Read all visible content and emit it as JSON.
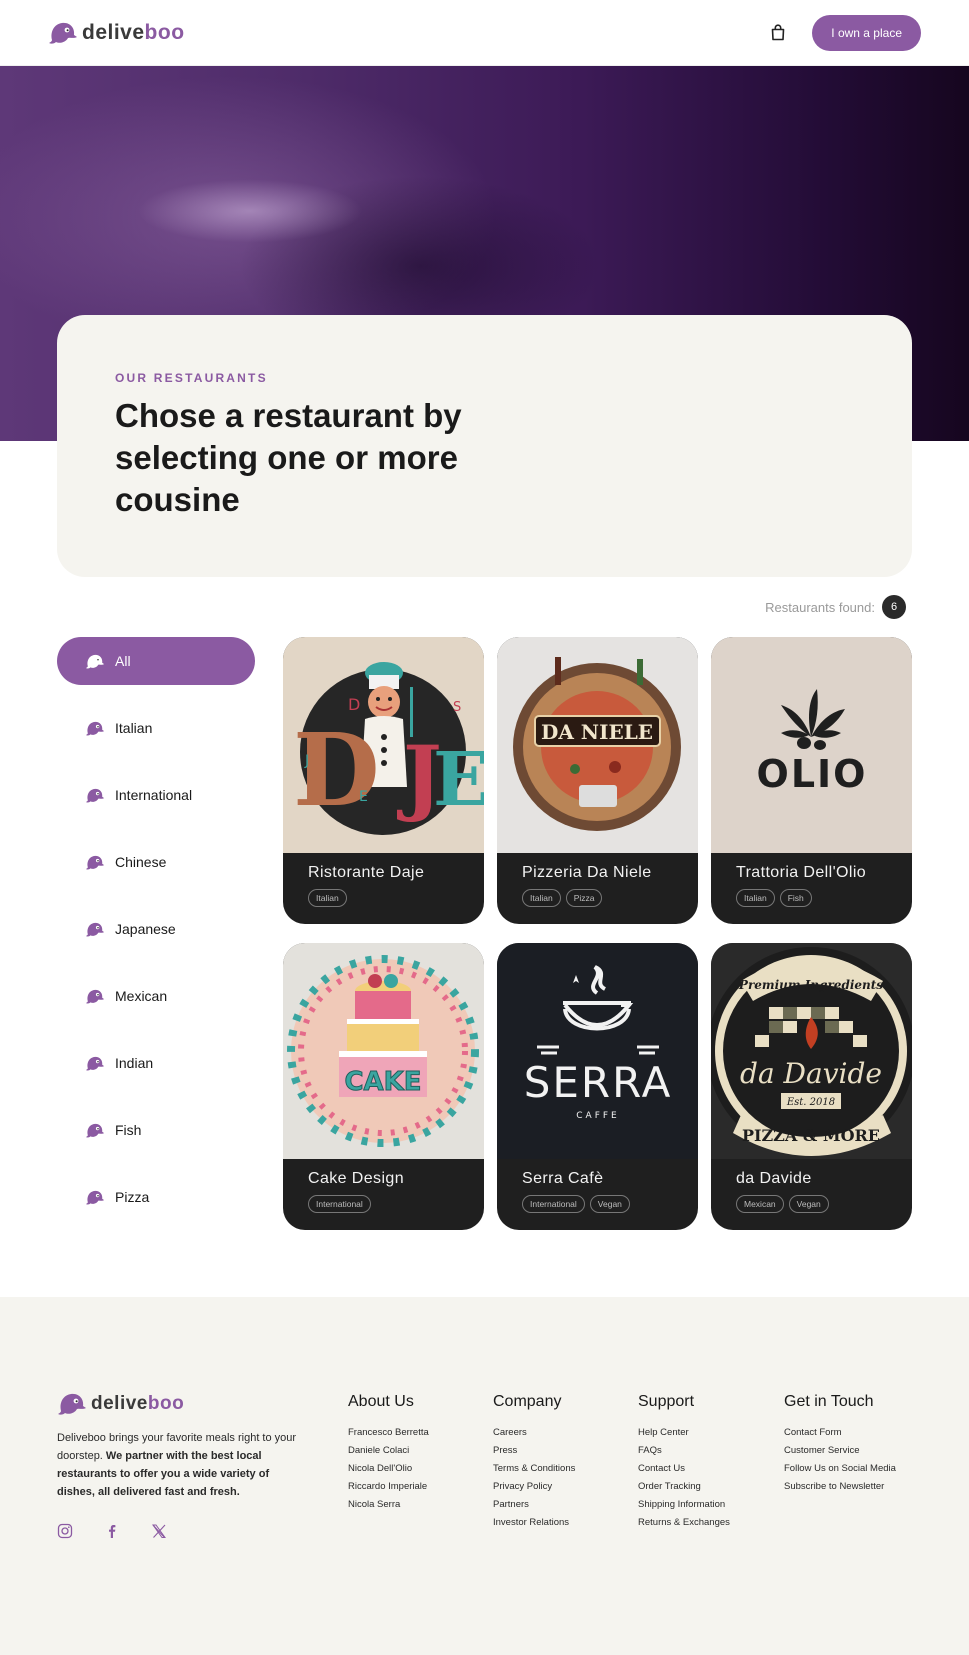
{
  "brand": {
    "name_part1": "delive",
    "name_part2": "boo",
    "accent": "#8b5aa2"
  },
  "navbar": {
    "cta_label": "I own a place",
    "cart_icon": "shopping-bag-icon"
  },
  "intro": {
    "eyebrow": "OUR RESTAURANTS",
    "headline": "Chose a restaurant by selecting one or more cousine"
  },
  "results": {
    "label": "Restaurants found:",
    "count": "6"
  },
  "categories": [
    {
      "label": "All",
      "active": true
    },
    {
      "label": "Italian"
    },
    {
      "label": "International"
    },
    {
      "label": "Chinese"
    },
    {
      "label": "Japanese"
    },
    {
      "label": "Mexican"
    },
    {
      "label": "Indian"
    },
    {
      "label": "Fish"
    },
    {
      "label": "Pizza"
    }
  ],
  "restaurants": [
    {
      "name": "Ristorante Daje",
      "tags": [
        "Italian"
      ],
      "logo_text": "Daje",
      "logo_letters": [
        "D",
        "D",
        "S",
        "J",
        "E"
      ]
    },
    {
      "name": "Pizzeria Da Niele",
      "tags": [
        "Italian",
        "Pizza"
      ],
      "logo_text": "DA NIELE"
    },
    {
      "name": "Trattoria Dell'Olio",
      "tags": [
        "Italian",
        "Fish"
      ],
      "logo_text": "OLIO"
    },
    {
      "name": "Cake Design",
      "tags": [
        "International"
      ],
      "logo_text": "CAKE"
    },
    {
      "name": "Serra Cafè",
      "tags": [
        "International",
        "Vegan"
      ],
      "logo_text": "SERRA",
      "logo_sub": "CAFFE"
    },
    {
      "name": "da Davide",
      "tags": [
        "Mexican",
        "Vegan"
      ],
      "logo_text": "da Davide",
      "logo_top": "Premium Ingredients",
      "logo_est": "Est. 2018",
      "logo_bottom": "PIZZA & MORE"
    }
  ],
  "footer": {
    "description_plain": "Deliveboo brings your favorite meals right to your doorstep. ",
    "description_bold": "We partner with the best local restaurants to offer you a wide variety of dishes, all delivered fast and fresh.",
    "socials": [
      "instagram-icon",
      "facebook-icon",
      "x-icon"
    ],
    "columns": [
      {
        "title": "About Us",
        "links": [
          "Francesco Berretta",
          "Daniele Colaci",
          "Nicola Dell'Olio",
          "Riccardo Imperiale",
          "Nicola Serra"
        ]
      },
      {
        "title": "Company",
        "links": [
          "Careers",
          "Press",
          "Terms & Conditions",
          "Privacy Policy",
          "Partners",
          "Investor Relations"
        ]
      },
      {
        "title": "Support",
        "links": [
          "Help Center",
          "FAQs",
          "Contact Us",
          "Order Tracking",
          "Shipping Information",
          "Returns & Exchanges"
        ]
      },
      {
        "title": "Get in Touch",
        "links": [
          "Contact Form",
          "Customer Service",
          "Follow Us on Social Media",
          "Subscribe to Newsletter"
        ]
      }
    ]
  }
}
